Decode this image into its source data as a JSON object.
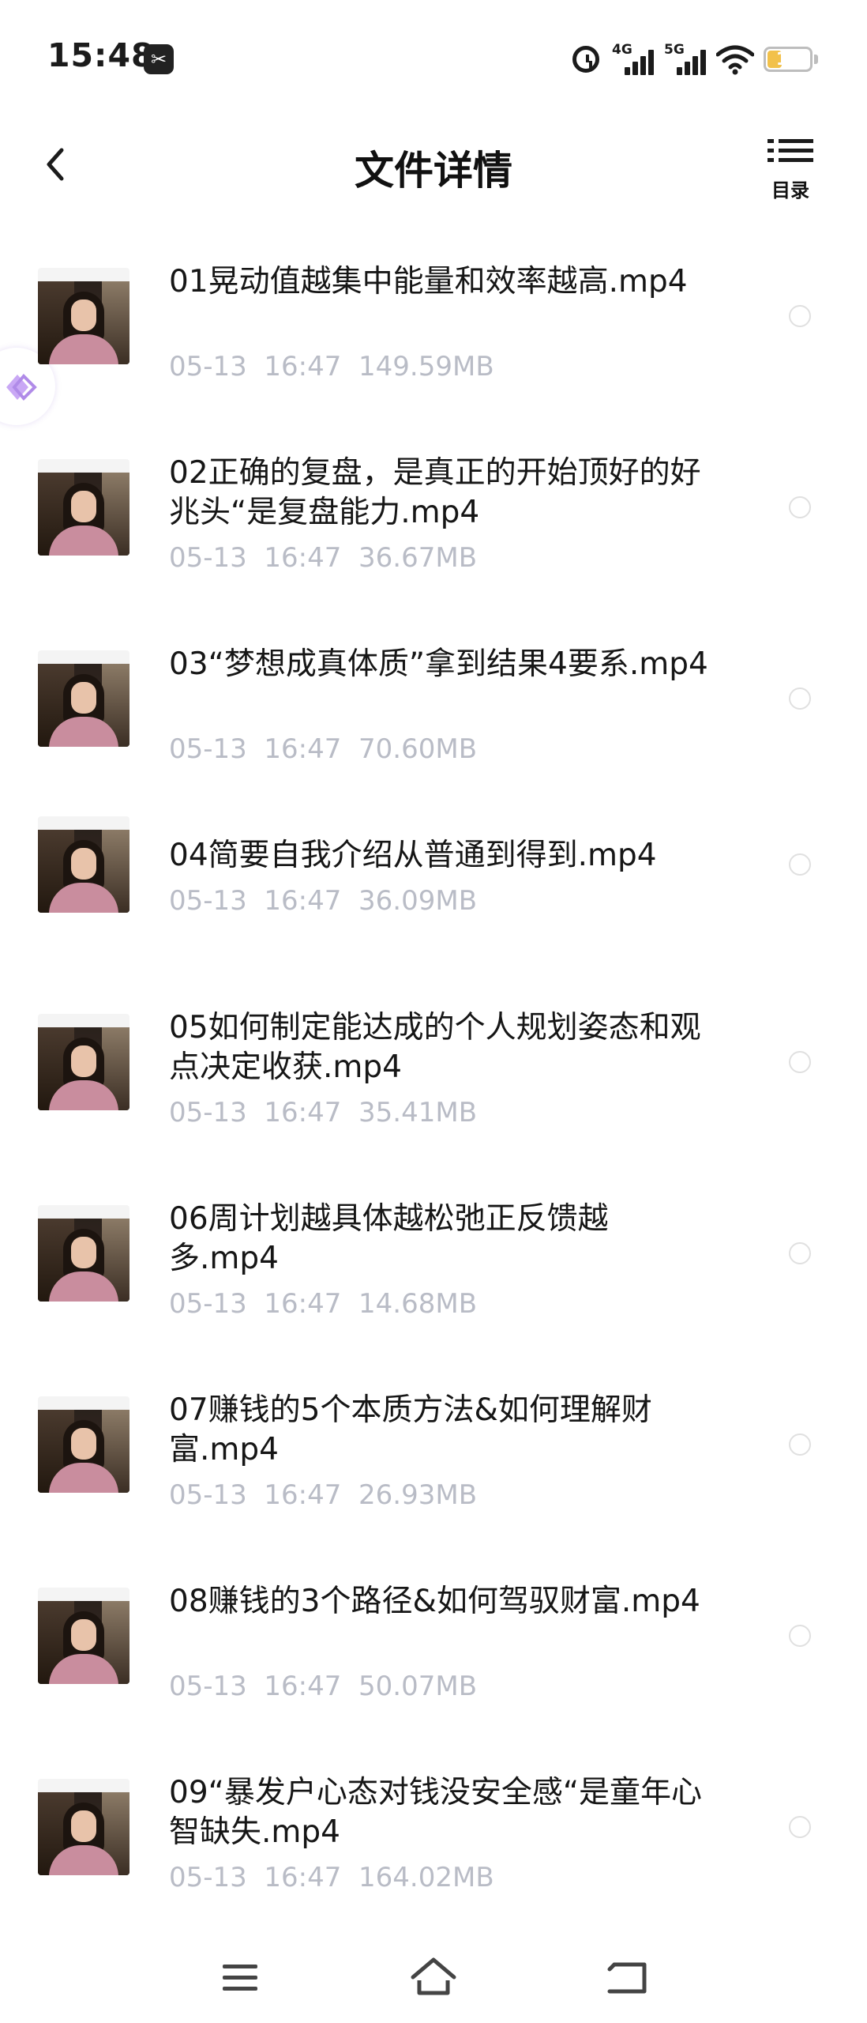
{
  "status": {
    "time": "15:48",
    "screenshot_icon": "✂",
    "net1": "4G",
    "net2": "5G",
    "battery": "16"
  },
  "header": {
    "title": "文件详情",
    "toc_label": "目录"
  },
  "files": [
    {
      "name": "01晃动值越集中能量和效率越高.mp4",
      "date": "05-13",
      "time": "16:47",
      "size": "149.59MB"
    },
    {
      "name": "02正确的复盘，是真正的开始顶好的好兆头“是复盘能力.mp4",
      "date": "05-13",
      "time": "16:47",
      "size": "36.67MB"
    },
    {
      "name": "03“梦想成真体质”拿到结果4要系.mp4",
      "date": "05-13",
      "time": "16:47",
      "size": "70.60MB"
    },
    {
      "name": "04简要自我介绍从普通到得到.mp4",
      "date": "05-13",
      "time": "16:47",
      "size": "36.09MB"
    },
    {
      "name": "05如何制定能达成的个人规划姿态和观点决定收获.mp4",
      "date": "05-13",
      "time": "16:47",
      "size": "35.41MB"
    },
    {
      "name": "06周计划越具体越松弛正反馈越多.mp4",
      "date": "05-13",
      "time": "16:47",
      "size": "14.68MB"
    },
    {
      "name": "07赚钱的5个本质方法&如何理解财富.mp4",
      "date": "05-13",
      "time": "16:47",
      "size": "26.93MB"
    },
    {
      "name": "08赚钱的3个路径&如何驾驭财富.mp4",
      "date": "05-13",
      "time": "16:47",
      "size": "50.07MB"
    },
    {
      "name": "09“暴发户心态对钱没安全感“是童年心智缺失.mp4",
      "date": "05-13",
      "time": "16:47",
      "size": "164.02MB"
    }
  ]
}
